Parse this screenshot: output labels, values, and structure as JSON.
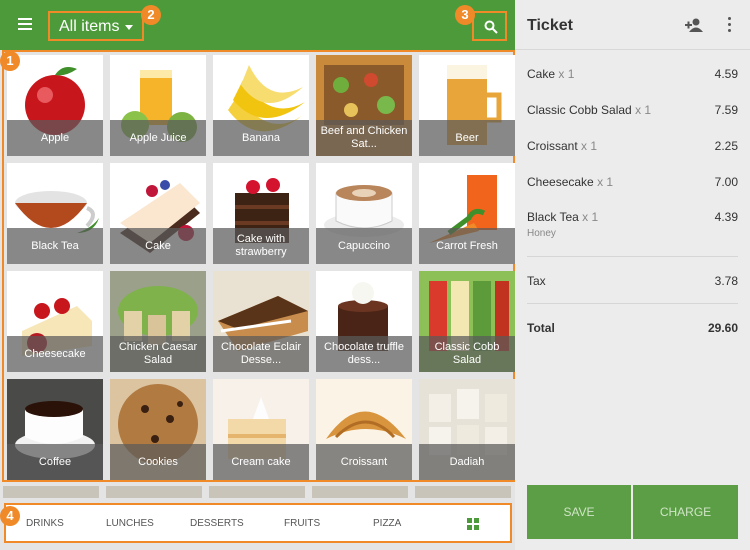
{
  "colors": {
    "primary": "#4c9a3a",
    "callout": "#f08a28",
    "button": "#5b9e45"
  },
  "callouts": [
    "1",
    "2",
    "3",
    "4"
  ],
  "header": {
    "category": "All items"
  },
  "items": [
    {
      "label": "Apple"
    },
    {
      "label": "Apple Juice"
    },
    {
      "label": "Banana"
    },
    {
      "label": "Beef and Chicken Sat..."
    },
    {
      "label": "Beer"
    },
    {
      "label": "Black Tea"
    },
    {
      "label": "Cake"
    },
    {
      "label": "Cake with strawberry"
    },
    {
      "label": "Capuccino"
    },
    {
      "label": "Carrot Fresh"
    },
    {
      "label": "Cheesecake"
    },
    {
      "label": "Chicken Caesar Salad"
    },
    {
      "label": "Chocolate Eclair Desse..."
    },
    {
      "label": "Chocolate truffle dess..."
    },
    {
      "label": "Classic Cobb Salad"
    },
    {
      "label": "Coffee"
    },
    {
      "label": "Cookies"
    },
    {
      "label": "Cream cake"
    },
    {
      "label": "Croissant"
    },
    {
      "label": "Dadiah"
    }
  ],
  "categories": [
    "DRINKS",
    "LUNCHES",
    "DESSERTS",
    "FRUITS",
    "PIZZA"
  ],
  "ticket": {
    "title": "Ticket",
    "lines": [
      {
        "name": "Cake",
        "qty": "x 1",
        "price": "4.59"
      },
      {
        "name": "Classic Cobb Salad",
        "qty": "x 1",
        "price": "7.59"
      },
      {
        "name": "Croissant",
        "qty": "x 1",
        "price": "2.25"
      },
      {
        "name": "Cheesecake",
        "qty": "x 1",
        "price": "7.00"
      },
      {
        "name": "Black Tea",
        "qty": "x 1",
        "price": "4.39",
        "note": "Honey"
      }
    ],
    "tax_label": "Tax",
    "tax": "3.78",
    "total_label": "Total",
    "total": "29.60",
    "save": "SAVE",
    "charge": "CHARGE"
  }
}
